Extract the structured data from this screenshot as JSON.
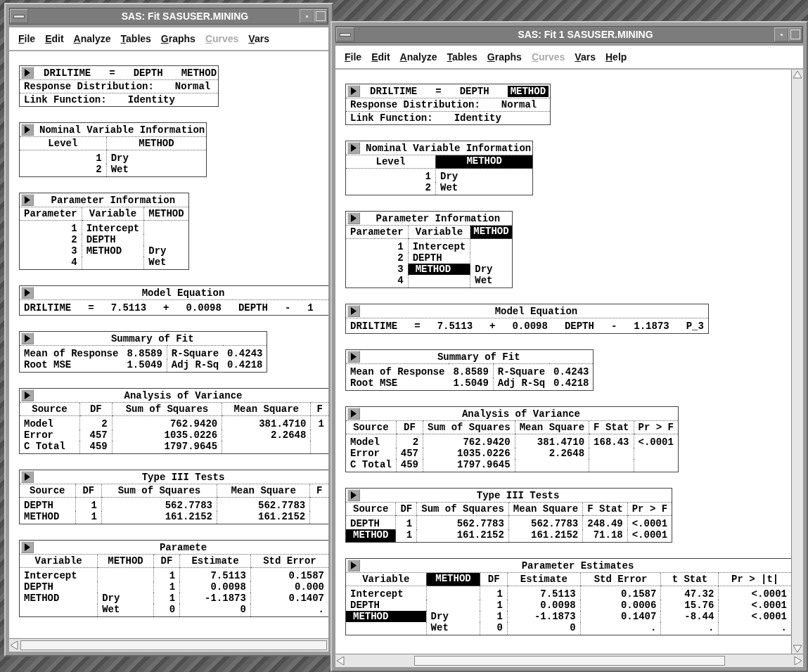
{
  "windows": [
    {
      "title": "SAS: Fit SASUSER.MINING",
      "vertical_scrollbar": false,
      "menus": [
        {
          "label": "File",
          "disabled": false
        },
        {
          "label": "Edit",
          "disabled": false
        },
        {
          "label": "Analyze",
          "disabled": false
        },
        {
          "label": "Tables",
          "disabled": false
        },
        {
          "label": "Graphs",
          "disabled": false
        },
        {
          "label": "Curves",
          "disabled": true
        },
        {
          "label": "Vars",
          "disabled": false
        }
      ],
      "panels": [
        {
          "kind": "spec",
          "clipped": false,
          "heading": [
            {
              "text": "DRILTIME",
              "selected": false
            },
            {
              "text": "=",
              "selected": false
            },
            {
              "text": "DEPTH",
              "selected": false
            },
            {
              "text": "METHOD",
              "selected": false
            }
          ],
          "lines": [
            {
              "label": "Response Distribution:",
              "value": "Normal"
            },
            {
              "label": "Link Function:",
              "value": "Identity"
            }
          ]
        },
        {
          "kind": "table",
          "clipped": false,
          "title": "Nominal Variable Information",
          "columns": [
            {
              "text": "Level",
              "selected": false,
              "kind": "numeric"
            },
            {
              "text": "METHOD",
              "selected": false,
              "kind": "text"
            }
          ],
          "rows": [
            [
              {
                "text": "1",
                "selected": false
              },
              {
                "text": "Dry",
                "selected": false
              }
            ],
            [
              {
                "text": "2",
                "selected": false
              },
              {
                "text": "Wet",
                "selected": false
              }
            ]
          ]
        },
        {
          "kind": "table",
          "clipped": false,
          "title": "Parameter Information",
          "columns": [
            {
              "text": "Parameter",
              "selected": false,
              "kind": "numeric"
            },
            {
              "text": "Variable",
              "selected": false,
              "kind": "text"
            },
            {
              "text": "METHOD",
              "selected": false,
              "kind": "text"
            }
          ],
          "rows": [
            [
              {
                "text": "1",
                "selected": false
              },
              {
                "text": "Intercept",
                "selected": false
              },
              null
            ],
            [
              {
                "text": "2",
                "selected": false
              },
              {
                "text": "DEPTH",
                "selected": false
              },
              null
            ],
            [
              {
                "text": "3",
                "selected": false
              },
              {
                "text": "METHOD",
                "selected": false
              },
              {
                "text": "Dry",
                "selected": false
              }
            ],
            [
              {
                "text": "4",
                "selected": false
              },
              null,
              {
                "text": "Wet",
                "selected": false
              }
            ]
          ]
        },
        {
          "kind": "equation",
          "clipped": true,
          "title": "Model Equation",
          "terms": [
            "DRILTIME",
            "=",
            "7.5113",
            "+",
            "0.0098",
            "DEPTH",
            "-",
            "1"
          ]
        },
        {
          "kind": "pairs",
          "clipped": false,
          "title": "Summary of Fit",
          "rows": [
            [
              {
                "label": "Mean of Response",
                "value": "8.8589"
              },
              {
                "label": "R-Square",
                "value": "0.4243"
              }
            ],
            [
              {
                "label": "Root MSE",
                "value": "1.5049"
              },
              {
                "label": "Adj R-Sq",
                "value": "0.4218"
              }
            ]
          ]
        },
        {
          "kind": "table",
          "clipped": true,
          "title": "Analysis of Variance",
          "columns": [
            {
              "text": "Source",
              "selected": false,
              "kind": "text"
            },
            {
              "text": "DF",
              "selected": false,
              "kind": "numeric"
            },
            {
              "text": "Sum of Squares",
              "selected": false,
              "kind": "numeric"
            },
            {
              "text": "Mean Square",
              "selected": false,
              "kind": "numeric"
            },
            {
              "text": "F",
              "selected": false,
              "kind": "numeric"
            }
          ],
          "rows": [
            [
              {
                "text": "Model",
                "selected": false
              },
              {
                "text": "2",
                "selected": false
              },
              {
                "text": "762.9420",
                "selected": false
              },
              {
                "text": "381.4710",
                "selected": false
              },
              {
                "text": "1",
                "selected": false
              }
            ],
            [
              {
                "text": "Error",
                "selected": false
              },
              {
                "text": "457",
                "selected": false
              },
              {
                "text": "1035.0226",
                "selected": false
              },
              {
                "text": "2.2648",
                "selected": false
              },
              null
            ],
            [
              {
                "text": "C Total",
                "selected": false
              },
              {
                "text": "459",
                "selected": false
              },
              {
                "text": "1797.9645",
                "selected": false
              },
              null,
              null
            ]
          ]
        },
        {
          "kind": "table",
          "clipped": true,
          "title": "Type III Tests",
          "columns": [
            {
              "text": "Source",
              "selected": false,
              "kind": "text"
            },
            {
              "text": "DF",
              "selected": false,
              "kind": "numeric"
            },
            {
              "text": "Sum of Squares",
              "selected": false,
              "kind": "numeric"
            },
            {
              "text": "Mean Square",
              "selected": false,
              "kind": "numeric"
            },
            {
              "text": "F",
              "selected": false,
              "kind": "numeric"
            }
          ],
          "rows": [
            [
              {
                "text": "DEPTH",
                "selected": false
              },
              {
                "text": "1",
                "selected": false
              },
              {
                "text": "562.7783",
                "selected": false
              },
              {
                "text": "562.7783",
                "selected": false
              },
              null
            ],
            [
              {
                "text": "METHOD",
                "selected": false
              },
              {
                "text": "1",
                "selected": false
              },
              {
                "text": "161.2152",
                "selected": false
              },
              {
                "text": "161.2152",
                "selected": false
              },
              null
            ]
          ]
        },
        {
          "kind": "table",
          "clipped": true,
          "title": "Paramete",
          "columns": [
            {
              "text": "Variable",
              "selected": false,
              "kind": "text"
            },
            {
              "text": "METHOD",
              "selected": false,
              "kind": "text"
            },
            {
              "text": "DF",
              "selected": false,
              "kind": "numeric"
            },
            {
              "text": "Estimate",
              "selected": false,
              "kind": "numeric"
            },
            {
              "text": "Std Error",
              "selected": false,
              "kind": "numeric"
            }
          ],
          "rows": [
            [
              {
                "text": "Intercept",
                "selected": false
              },
              null,
              {
                "text": "1",
                "selected": false
              },
              {
                "text": "7.5113",
                "selected": false
              },
              {
                "text": "0.1587",
                "selected": false
              }
            ],
            [
              {
                "text": "DEPTH",
                "selected": false
              },
              null,
              {
                "text": "1",
                "selected": false
              },
              {
                "text": "0.0098",
                "selected": false
              },
              {
                "text": "0.000",
                "selected": false
              }
            ],
            [
              {
                "text": "METHOD",
                "selected": false
              },
              {
                "text": "Dry",
                "selected": false
              },
              {
                "text": "1",
                "selected": false
              },
              {
                "text": "-1.1873",
                "selected": false
              },
              {
                "text": "0.1407",
                "selected": false
              }
            ],
            [
              null,
              {
                "text": "Wet",
                "selected": false
              },
              {
                "text": "0",
                "selected": false
              },
              {
                "text": "0",
                "selected": false
              },
              {
                "text": ".",
                "selected": false
              }
            ]
          ]
        }
      ]
    },
    {
      "title": "SAS: Fit 1 SASUSER.MINING",
      "vertical_scrollbar": true,
      "menus": [
        {
          "label": "File",
          "disabled": false
        },
        {
          "label": "Edit",
          "disabled": false
        },
        {
          "label": "Analyze",
          "disabled": false
        },
        {
          "label": "Tables",
          "disabled": false
        },
        {
          "label": "Graphs",
          "disabled": false
        },
        {
          "label": "Curves",
          "disabled": true
        },
        {
          "label": "Vars",
          "disabled": false
        },
        {
          "label": "Help",
          "disabled": false
        }
      ],
      "panels": [
        {
          "kind": "spec",
          "clipped": false,
          "heading": [
            {
              "text": "DRILTIME",
              "selected": false
            },
            {
              "text": "=",
              "selected": false
            },
            {
              "text": "DEPTH",
              "selected": false
            },
            {
              "text": "METHOD",
              "selected": true
            }
          ],
          "lines": [
            {
              "label": "Response Distribution:",
              "value": "Normal"
            },
            {
              "label": "Link Function:",
              "value": "Identity"
            }
          ]
        },
        {
          "kind": "table",
          "clipped": false,
          "title": "Nominal Variable Information",
          "columns": [
            {
              "text": "Level",
              "selected": false,
              "kind": "numeric"
            },
            {
              "text": "METHOD",
              "selected": true,
              "kind": "text"
            }
          ],
          "rows": [
            [
              {
                "text": "1",
                "selected": false
              },
              {
                "text": "Dry",
                "selected": false
              }
            ],
            [
              {
                "text": "2",
                "selected": false
              },
              {
                "text": "Wet",
                "selected": false
              }
            ]
          ]
        },
        {
          "kind": "table",
          "clipped": false,
          "title": "Parameter Information",
          "columns": [
            {
              "text": "Parameter",
              "selected": false,
              "kind": "numeric"
            },
            {
              "text": "Variable",
              "selected": false,
              "kind": "text"
            },
            {
              "text": "METHOD",
              "selected": true,
              "kind": "text"
            }
          ],
          "rows": [
            [
              {
                "text": "1",
                "selected": false
              },
              {
                "text": "Intercept",
                "selected": false
              },
              null
            ],
            [
              {
                "text": "2",
                "selected": false
              },
              {
                "text": "DEPTH",
                "selected": false
              },
              null
            ],
            [
              {
                "text": "3",
                "selected": false
              },
              {
                "text": "METHOD",
                "selected": true
              },
              {
                "text": "Dry",
                "selected": false
              }
            ],
            [
              {
                "text": "4",
                "selected": false
              },
              null,
              {
                "text": "Wet",
                "selected": false
              }
            ]
          ]
        },
        {
          "kind": "equation",
          "clipped": false,
          "title": "Model Equation",
          "terms": [
            "DRILTIME",
            "=",
            "7.5113",
            "+",
            "0.0098",
            "DEPTH",
            "-",
            "1.1873",
            "P_3"
          ]
        },
        {
          "kind": "pairs",
          "clipped": false,
          "title": "Summary of Fit",
          "rows": [
            [
              {
                "label": "Mean of Response",
                "value": "8.8589"
              },
              {
                "label": "R-Square",
                "value": "0.4243"
              }
            ],
            [
              {
                "label": "Root MSE",
                "value": "1.5049"
              },
              {
                "label": "Adj R-Sq",
                "value": "0.4218"
              }
            ]
          ]
        },
        {
          "kind": "table",
          "clipped": false,
          "title": "Analysis of Variance",
          "columns": [
            {
              "text": "Source",
              "selected": false,
              "kind": "text"
            },
            {
              "text": "DF",
              "selected": false,
              "kind": "numeric"
            },
            {
              "text": "Sum of Squares",
              "selected": false,
              "kind": "numeric"
            },
            {
              "text": "Mean Square",
              "selected": false,
              "kind": "numeric"
            },
            {
              "text": "F Stat",
              "selected": false,
              "kind": "numeric"
            },
            {
              "text": "Pr > F",
              "selected": false,
              "kind": "numeric"
            }
          ],
          "rows": [
            [
              {
                "text": "Model",
                "selected": false
              },
              {
                "text": "2",
                "selected": false
              },
              {
                "text": "762.9420",
                "selected": false
              },
              {
                "text": "381.4710",
                "selected": false
              },
              {
                "text": "168.43",
                "selected": false
              },
              {
                "text": "<.0001",
                "selected": false
              }
            ],
            [
              {
                "text": "Error",
                "selected": false
              },
              {
                "text": "457",
                "selected": false
              },
              {
                "text": "1035.0226",
                "selected": false
              },
              {
                "text": "2.2648",
                "selected": false
              },
              null,
              null
            ],
            [
              {
                "text": "C Total",
                "selected": false
              },
              {
                "text": "459",
                "selected": false
              },
              {
                "text": "1797.9645",
                "selected": false
              },
              null,
              null,
              null
            ]
          ]
        },
        {
          "kind": "table",
          "clipped": false,
          "title": "Type III Tests",
          "columns": [
            {
              "text": "Source",
              "selected": false,
              "kind": "text"
            },
            {
              "text": "DF",
              "selected": false,
              "kind": "numeric"
            },
            {
              "text": "Sum of Squares",
              "selected": false,
              "kind": "numeric"
            },
            {
              "text": "Mean Square",
              "selected": false,
              "kind": "numeric"
            },
            {
              "text": "F Stat",
              "selected": false,
              "kind": "numeric"
            },
            {
              "text": "Pr > F",
              "selected": false,
              "kind": "numeric"
            }
          ],
          "rows": [
            [
              {
                "text": "DEPTH",
                "selected": false
              },
              {
                "text": "1",
                "selected": false
              },
              {
                "text": "562.7783",
                "selected": false
              },
              {
                "text": "562.7783",
                "selected": false
              },
              {
                "text": "248.49",
                "selected": false
              },
              {
                "text": "<.0001",
                "selected": false
              }
            ],
            [
              {
                "text": "METHOD",
                "selected": true
              },
              {
                "text": "1",
                "selected": false
              },
              {
                "text": "161.2152",
                "selected": false
              },
              {
                "text": "161.2152",
                "selected": false
              },
              {
                "text": "71.18",
                "selected": false
              },
              {
                "text": "<.0001",
                "selected": false
              }
            ]
          ]
        },
        {
          "kind": "table",
          "clipped": true,
          "title": "Parameter Estimates",
          "columns": [
            {
              "text": "Variable",
              "selected": false,
              "kind": "text"
            },
            {
              "text": "METHOD",
              "selected": true,
              "kind": "text"
            },
            {
              "text": "DF",
              "selected": false,
              "kind": "numeric"
            },
            {
              "text": "Estimate",
              "selected": false,
              "kind": "numeric"
            },
            {
              "text": "Std Error",
              "selected": false,
              "kind": "numeric"
            },
            {
              "text": "t Stat",
              "selected": false,
              "kind": "numeric"
            },
            {
              "text": "Pr > |t|",
              "selected": false,
              "kind": "numeric"
            }
          ],
          "rows": [
            [
              {
                "text": "Intercept",
                "selected": false
              },
              null,
              {
                "text": "1",
                "selected": false
              },
              {
                "text": "7.5113",
                "selected": false
              },
              {
                "text": "0.1587",
                "selected": false
              },
              {
                "text": "47.32",
                "selected": false
              },
              {
                "text": "<.0001",
                "selected": false
              }
            ],
            [
              {
                "text": "DEPTH",
                "selected": false
              },
              null,
              {
                "text": "1",
                "selected": false
              },
              {
                "text": "0.0098",
                "selected": false
              },
              {
                "text": "0.0006",
                "selected": false
              },
              {
                "text": "15.76",
                "selected": false
              },
              {
                "text": "<.0001",
                "selected": false
              }
            ],
            [
              {
                "text": "METHOD",
                "selected": true
              },
              {
                "text": "Dry",
                "selected": false
              },
              {
                "text": "1",
                "selected": false
              },
              {
                "text": "-1.1873",
                "selected": false
              },
              {
                "text": "0.1407",
                "selected": false
              },
              {
                "text": "-8.44",
                "selected": false
              },
              {
                "text": "<.0001",
                "selected": false
              }
            ],
            [
              null,
              {
                "text": "Wet",
                "selected": false
              },
              {
                "text": "0",
                "selected": false
              },
              {
                "text": "0",
                "selected": false
              },
              {
                "text": ".",
                "selected": false
              },
              {
                "text": ".",
                "selected": false
              },
              {
                "text": ".",
                "selected": false
              }
            ]
          ]
        }
      ]
    }
  ]
}
